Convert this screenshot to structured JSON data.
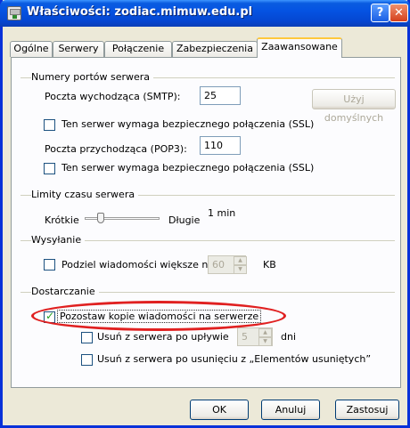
{
  "window": {
    "title": "Właściwości: zodiac.mimuw.edu.pl",
    "help_label": "?",
    "close_label": "✕"
  },
  "tabs": [
    {
      "label": "Ogólne",
      "active": false
    },
    {
      "label": "Serwery",
      "active": false
    },
    {
      "label": "Połączenie",
      "active": false
    },
    {
      "label": "Zabezpieczenia",
      "active": false
    },
    {
      "label": "Zaawansowane",
      "active": true
    }
  ],
  "ports": {
    "group_title": "Numery portów serwera",
    "smtp_label": "Poczta wychodząca (SMTP):",
    "smtp_value": "25",
    "defaults_button": "Użyj domyślnych",
    "smtp_ssl_label": "Ten serwer wymaga bezpiecznego połączenia (SSL)",
    "smtp_ssl_checked": false,
    "pop3_label": "Poczta przychodząca (POP3):",
    "pop3_value": "110",
    "pop3_ssl_label": "Ten serwer wymaga bezpiecznego połączenia (SSL)",
    "pop3_ssl_checked": false
  },
  "timeouts": {
    "group_title": "Limity czasu serwera",
    "short_label": "Krótkie",
    "long_label": "Długie",
    "value": "1 min"
  },
  "sending": {
    "group_title": "Wysyłanie",
    "split_label": "Podziel wiadomości większe niż",
    "split_checked": false,
    "split_value": "60",
    "unit": "KB"
  },
  "delivery": {
    "group_title": "Dostarczanie",
    "keep_label": "Pozostaw kopie wiadomości na serwerze",
    "keep_checked": true,
    "remove_after_label": "Usuń z serwera po upływie",
    "remove_after_checked": false,
    "remove_after_value": "5",
    "days_label": "dni",
    "remove_deleted_label": "Usuń z serwera po usunięciu z „Elementów usuniętych”",
    "remove_deleted_checked": false,
    "highlight_color": "#e02020"
  },
  "buttons": {
    "ok": "OK",
    "cancel": "Anuluj",
    "apply": "Zastosuj"
  }
}
